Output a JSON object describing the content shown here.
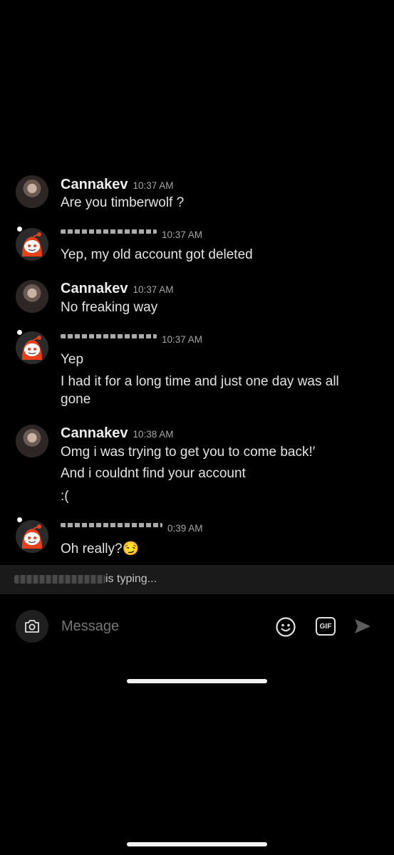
{
  "messages": [
    {
      "sender": "Cannakev",
      "time": "10:37 AM",
      "lines": [
        "Are you timberwolf     ?"
      ]
    },
    {
      "sender": "",
      "time": "10:37 AM",
      "lines": [
        "Yep, my old account got deleted"
      ]
    },
    {
      "sender": "Cannakev",
      "time": "10:37 AM",
      "lines": [
        "No freaking way"
      ]
    },
    {
      "sender": "",
      "time": "10:37 AM",
      "lines": [
        "Yep",
        "I had it for a long time and just one day was all",
        "gone"
      ]
    },
    {
      "sender": "Cannakev",
      "time": "10:38 AM",
      "lines": [
        "Omg i was trying to get you to come back!′",
        "And i couldnt find your account",
        ":("
      ]
    },
    {
      "sender": "",
      "time": "0:39 AM",
      "lines": [
        "Oh really?😏"
      ]
    }
  ],
  "typing": {
    "text": "is typing..."
  },
  "composer": {
    "placeholder": "Message",
    "gif_label": "GIF"
  },
  "icons": {
    "camera": "camera-icon",
    "emoji": "emoji-icon",
    "gif": "gif-icon",
    "send": "send-icon"
  },
  "colors": {
    "background": "#000000",
    "typing_bar": "#1a1a1b",
    "snoo_red": "#e8401c"
  }
}
